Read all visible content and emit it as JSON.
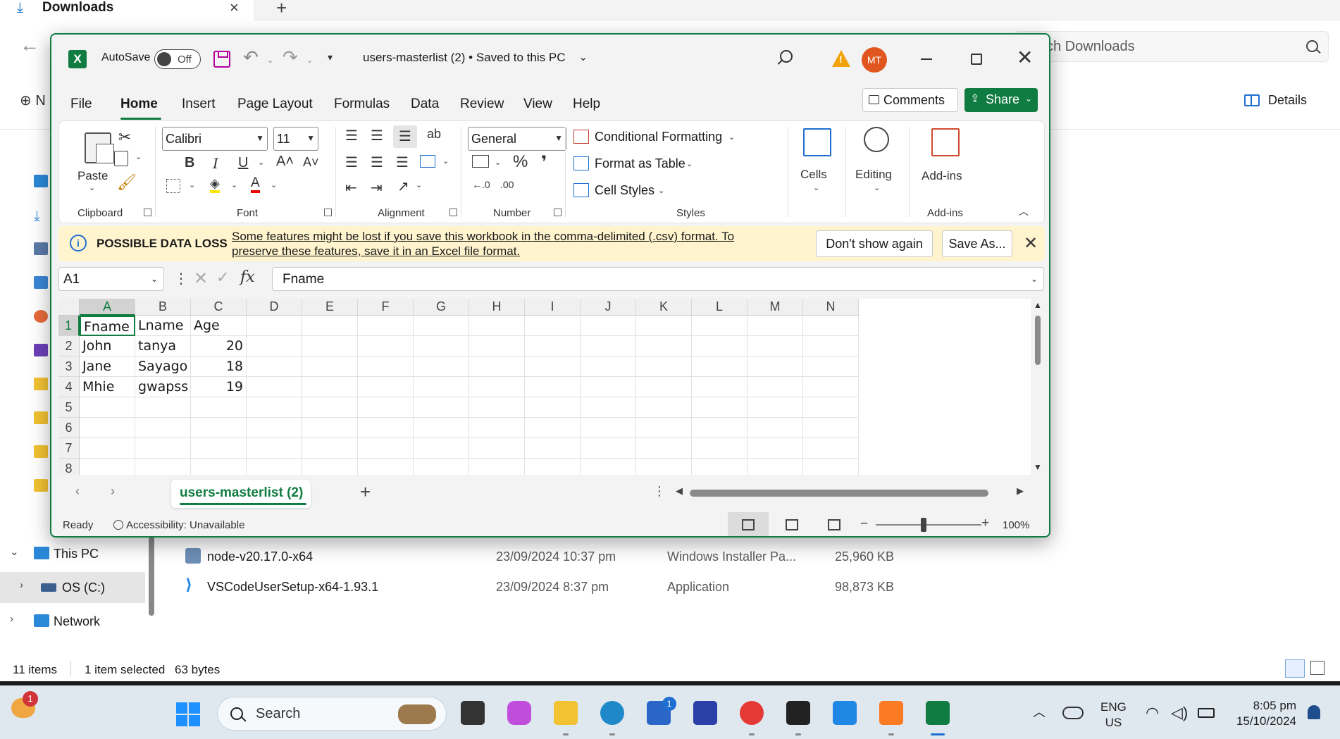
{
  "explorer": {
    "tab_title": "Downloads",
    "search_placeholder": "ch Downloads",
    "new_label": "N",
    "details_label": "Details",
    "nav_tree": [
      {
        "label": "This PC",
        "arrow": "⌄"
      },
      {
        "label": "OS (C:)",
        "arrow": "›"
      },
      {
        "label": "Network",
        "arrow": "›"
      }
    ],
    "files": [
      {
        "name": "node-v20.17.0-x64",
        "date": "23/09/2024 10:37 pm",
        "type": "Windows Installer Pa...",
        "size": "25,960 KB",
        "icon": "installer-icon"
      },
      {
        "name": "VSCodeUserSetup-x64-1.93.1",
        "date": "23/09/2024 8:37 pm",
        "type": "Application",
        "size": "98,873 KB",
        "icon": "vscode-icon"
      }
    ],
    "status": {
      "items": "11 items",
      "selected": "1 item selected",
      "size": "63 bytes"
    }
  },
  "excel": {
    "autosave_label": "AutoSave",
    "autosave_state": "Off",
    "title": "users-masterlist (2) • Saved to this PC",
    "avatar_initials": "MT",
    "menu_tabs": [
      "File",
      "Home",
      "Insert",
      "Page Layout",
      "Formulas",
      "Data",
      "Review",
      "View",
      "Help"
    ],
    "active_tab": "Home",
    "comments_label": "Comments",
    "share_label": "Share",
    "ribbon": {
      "paste_label": "Paste",
      "clipboard_label": "Clipboard",
      "font_name": "Calibri",
      "font_size": "11",
      "font_label": "Font",
      "alignment_label": "Alignment",
      "number_format": "General",
      "number_label": "Number",
      "conditional_formatting": "Conditional Formatting",
      "format_as_table": "Format as Table",
      "cell_styles": "Cell Styles",
      "styles_label": "Styles",
      "cells_label": "Cells",
      "editing_label": "Editing",
      "addins_label": "Add-ins",
      "addins_group_label": "Add-ins",
      "bold": "B",
      "italic": "I",
      "underline": "U"
    },
    "infobar": {
      "title": "POSSIBLE DATA LOSS",
      "message": "Some features might be lost if you save this workbook in the comma-delimited (.csv) format. To preserve these features, save it in an Excel file format.",
      "dont_show_label": "Don't show again",
      "save_as_label": "Save As..."
    },
    "formula_bar": {
      "name_box": "A1",
      "value": "Fname"
    },
    "columns": [
      "A",
      "B",
      "C",
      "D",
      "E",
      "F",
      "G",
      "H",
      "I",
      "J",
      "K",
      "L",
      "M",
      "N"
    ],
    "rows": [
      "1",
      "2",
      "3",
      "4",
      "5",
      "6",
      "7",
      "8"
    ],
    "cells": [
      [
        "Fname",
        "Lname",
        "Age"
      ],
      [
        "John",
        "tanya",
        "20"
      ],
      [
        "Jane",
        "Sayago",
        "18"
      ],
      [
        "Mhie",
        "gwapss",
        "19"
      ]
    ],
    "sheet_tab": "users-masterlist (2)",
    "status": {
      "ready": "Ready",
      "accessibility": "Accessibility: Unavailable",
      "zoom": "100%"
    },
    "colors": {
      "accent": "#107c41",
      "infobar": "#fff4ce"
    }
  },
  "taskbar": {
    "weather_badge": "1",
    "search_placeholder": "Search",
    "store_badge": "1",
    "lang_top": "ENG",
    "lang_bottom": "US",
    "time": "8:05 pm",
    "date": "15/10/2024"
  }
}
